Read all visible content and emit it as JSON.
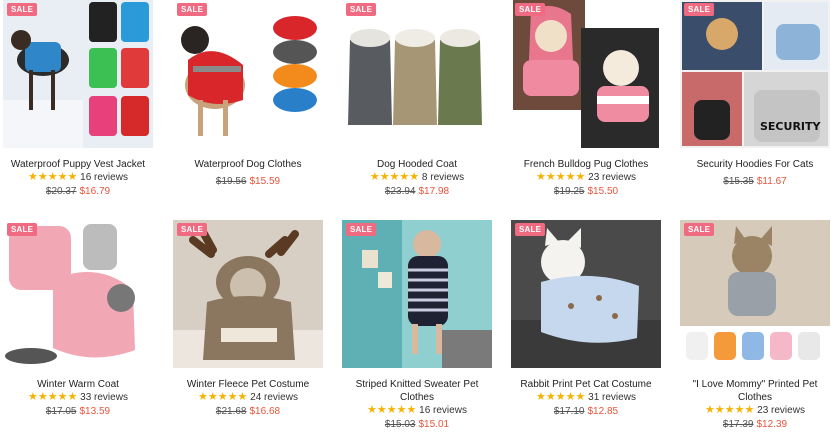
{
  "sale_label": "SALE",
  "star_glyphs": "★★★★★",
  "products": [
    {
      "title": "Waterproof Puppy Vest Jacket",
      "reviews": "16 reviews",
      "old_price": "$20.37",
      "new_price": "$16.79",
      "rating": 5
    },
    {
      "title": "Waterproof Dog Clothes",
      "reviews": "",
      "old_price": "$19.56",
      "new_price": "$15.59",
      "rating": 0
    },
    {
      "title": "Dog Hooded Coat",
      "reviews": "8 reviews",
      "old_price": "$23.94",
      "new_price": "$17.98",
      "rating": 5
    },
    {
      "title": "French Bulldog Pug Clothes",
      "reviews": "23 reviews",
      "old_price": "$19.25",
      "new_price": "$15.50",
      "rating": 5
    },
    {
      "title": "Security Hoodies For Cats",
      "reviews": "",
      "old_price": "$15.35",
      "new_price": "$11.67",
      "rating": 0
    },
    {
      "title": "Winter Warm Coat",
      "reviews": "33 reviews",
      "old_price": "$17.05",
      "new_price": "$13.59",
      "rating": 5
    },
    {
      "title": "Winter Fleece Pet Costume",
      "reviews": "24 reviews",
      "old_price": "$21.68",
      "new_price": "$16.68",
      "rating": 5
    },
    {
      "title": "Striped Knitted Sweater Pet Clothes",
      "reviews": "16 reviews",
      "old_price": "$15.03",
      "new_price": "$15.01",
      "rating": 5
    },
    {
      "title": "Rabbit Print Pet Cat Costume",
      "reviews": "31 reviews",
      "old_price": "$17.10",
      "new_price": "$12.85",
      "rating": 5
    },
    {
      "title": "\"I Love Mommy\" Printed Pet Clothes",
      "reviews": "23 reviews",
      "old_price": "$17.39",
      "new_price": "$12.39",
      "rating": 5
    }
  ],
  "colors": {
    "sale_badge": "#f06b82",
    "star": "#f5b301",
    "sale_price": "#e8553a"
  }
}
